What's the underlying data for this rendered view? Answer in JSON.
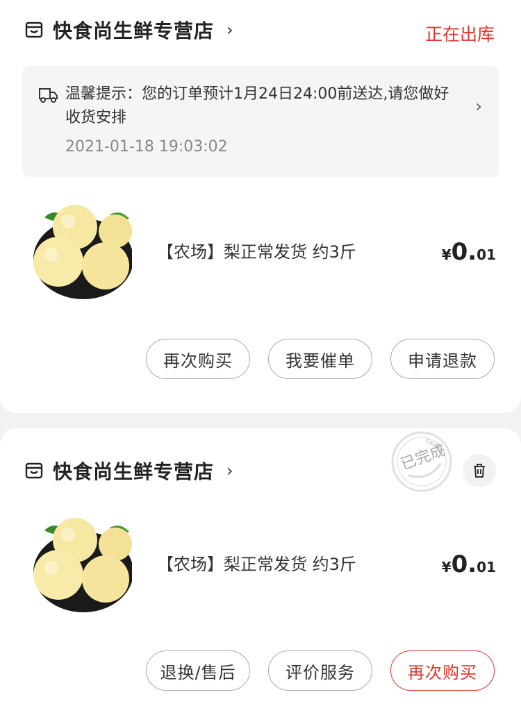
{
  "orders": [
    {
      "store_name": "快食尚生鲜专营店",
      "status": "正在出库",
      "notice": {
        "text": "温馨提示：您的订单预计1月24日24:00前送达,请您做好收货安排",
        "time": "2021-01-18 19:03:02"
      },
      "product": {
        "name": "【农场】梨正常发货 约3斤",
        "price_symbol": "¥",
        "price_int": "0.",
        "price_dec": "01"
      },
      "buttons": [
        "再次购买",
        "我要催单",
        "申请退款"
      ]
    },
    {
      "store_name": "快食尚生鲜专营店",
      "status_stamp": "已完成",
      "stamp_sub": "FINISH",
      "product": {
        "name": "【农场】梨正常发货 约3斤",
        "price_symbol": "¥",
        "price_int": "0.",
        "price_dec": "01"
      },
      "buttons": [
        "退换/售后",
        "评价服务",
        "再次购买"
      ]
    }
  ],
  "icons": {
    "store": "store-icon",
    "truck": "truck-icon",
    "trash": "trash-icon",
    "chevron": "chevron-right-icon"
  },
  "colors": {
    "accent": "#e0362c"
  }
}
